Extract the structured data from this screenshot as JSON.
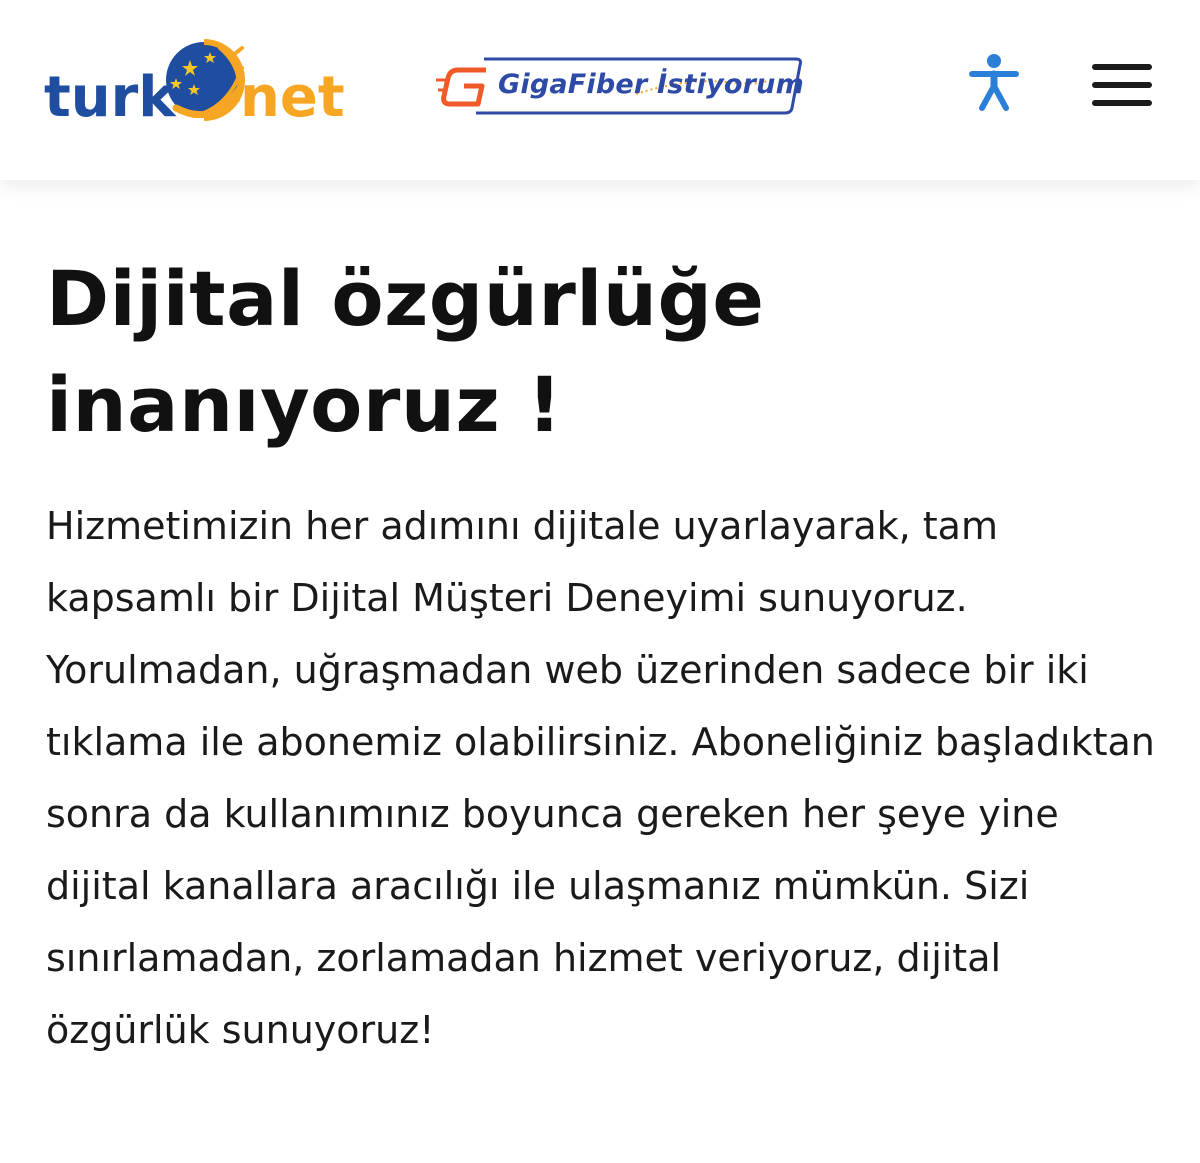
{
  "header": {
    "logo": {
      "text_left": "turk",
      "text_right": "net",
      "colors": {
        "blue": "#1f4ea1",
        "orange": "#f6a623"
      }
    },
    "promo": {
      "label": "GigaFiber İstiyorum",
      "icon": "gigafiber-g-icon",
      "colors": {
        "text": "#2d4aa6",
        "accent": "#f05a28"
      }
    },
    "accessibility_icon": "accessibility-icon",
    "menu_icon": "hamburger-menu-icon"
  },
  "main": {
    "title_line1": "Dijital özgürlüğe",
    "title_line2": "inanıyoruz !",
    "paragraph": "Hizmetimizin her adımını dijitale uyarlayarak, tam kapsamlı bir Dijital Müşteri Deneyimi sunuyoruz. Yorulmadan, uğraşmadan web üzerinden sadece bir iki tıklama ile abonemiz olabilirsiniz. Aboneliğiniz başladıktan sonra da kullanımınız boyunca gereken her şeye yine dijital kanallara aracılığı ile ulaşmanız mümkün. Sizi sınırlamadan, zorlamadan hizmet veriyoruz, dijital özgürlük sunuyoruz!"
  },
  "colors": {
    "accessibility_blue": "#2b7fd9",
    "text": "#111111",
    "background": "#ffffff"
  }
}
